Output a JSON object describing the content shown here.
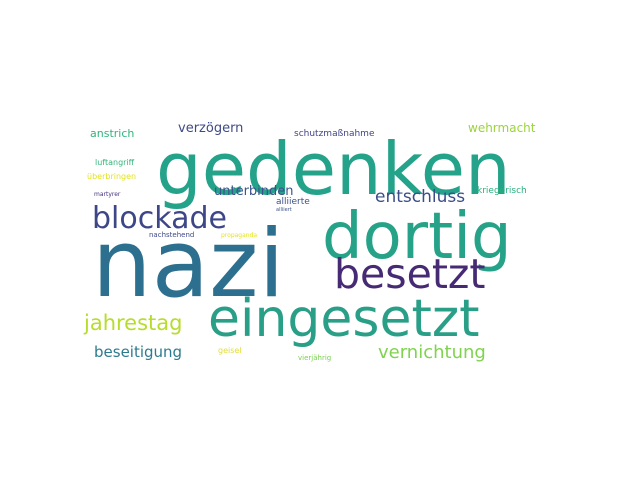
{
  "word_cloud": {
    "words": [
      {
        "text": "nazi",
        "color": "#2d6f8e"
      },
      {
        "text": "gedenken",
        "color": "#24a38a"
      },
      {
        "text": "dortig",
        "color": "#25a287"
      },
      {
        "text": "eingesetzt",
        "color": "#2a9f87"
      },
      {
        "text": "besetzt",
        "color": "#462a73"
      },
      {
        "text": "blockade",
        "color": "#3d4787"
      },
      {
        "text": "jahrestag",
        "color": "#b6dd2b"
      },
      {
        "text": "vernichtung",
        "color": "#7fd34e"
      },
      {
        "text": "entschluss",
        "color": "#3b4d89"
      },
      {
        "text": "beseitigung",
        "color": "#2d7b8e"
      },
      {
        "text": "unterbinden",
        "color": "#3a528b"
      },
      {
        "text": "verzögern",
        "color": "#3e4a88"
      },
      {
        "text": "wehrmacht",
        "color": "#9ad43a"
      },
      {
        "text": "anstrich",
        "color": "#2fb47c"
      },
      {
        "text": "schutzmaßnahme",
        "color": "#414487"
      },
      {
        "text": "luftangriff",
        "color": "#32b57a"
      },
      {
        "text": "überbringen",
        "color": "#e3e418"
      },
      {
        "text": "kriegerisch",
        "color": "#29af7f"
      },
      {
        "text": "martyrer",
        "color": "#46327e"
      },
      {
        "text": "alliierte",
        "color": "#3b528b"
      },
      {
        "text": "alliiert",
        "color": "#3b528b"
      },
      {
        "text": "nachstehend",
        "color": "#3e4989"
      },
      {
        "text": "propaganda",
        "color": "#e6e419"
      },
      {
        "text": "geisel",
        "color": "#e1dd37"
      },
      {
        "text": "vierjährig",
        "color": "#7ad151"
      }
    ]
  }
}
